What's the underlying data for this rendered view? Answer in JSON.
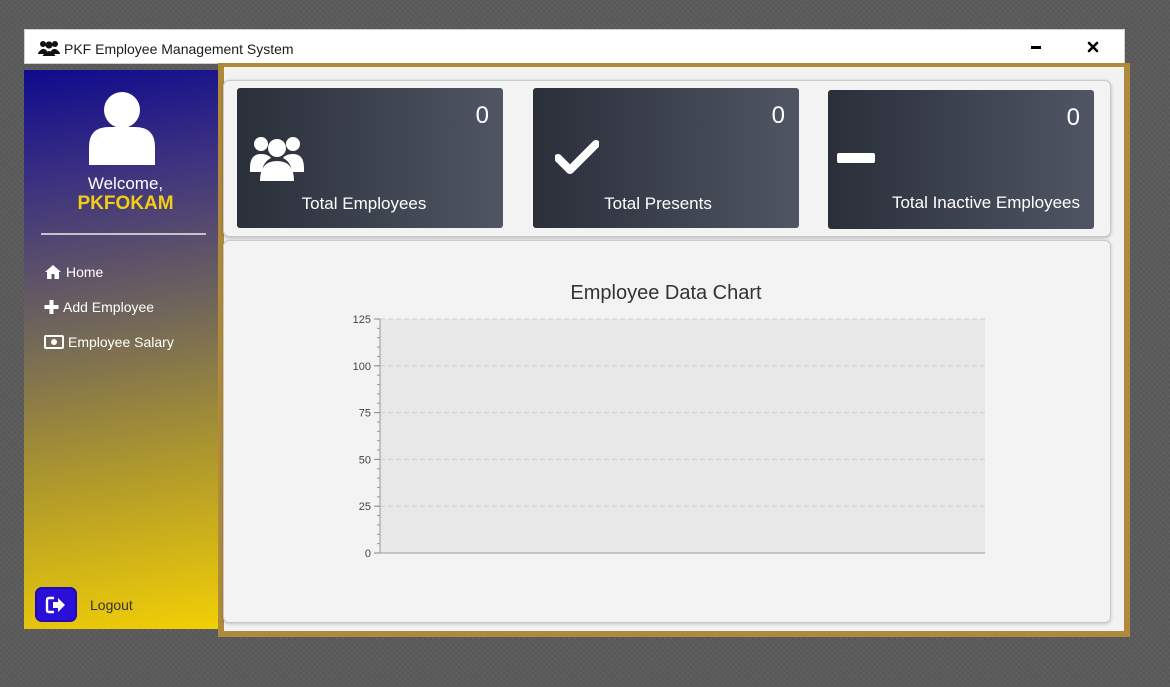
{
  "window": {
    "title": "PKF Employee Management System"
  },
  "sidebar": {
    "welcome": "Welcome,",
    "username": "PKFOKAM",
    "nav": [
      {
        "label": "Home",
        "icon": "home-icon"
      },
      {
        "label": "Add Employee",
        "icon": "plus-icon"
      },
      {
        "label": "Employee Salary",
        "icon": "money-bill-icon"
      }
    ],
    "logout_label": "Logout"
  },
  "cards": [
    {
      "count": "0",
      "label": "Total Employees",
      "icon": "users-icon"
    },
    {
      "count": "0",
      "label": "Total Presents",
      "icon": "check-icon"
    },
    {
      "count": "0",
      "label": "Total Inactive Employees",
      "icon": "minus-icon"
    }
  ],
  "colors": {
    "sidebar_top": "#0e0a8e",
    "sidebar_bottom": "#f2cf05",
    "username": "#f4cc14",
    "card_bg_dark": "#2a2f3a",
    "card_bg_light": "#4f5562",
    "logout_button": "#2a0fd8",
    "frame_border": "#b08a3c"
  },
  "chart_data": {
    "type": "bar",
    "title": "Employee Data Chart",
    "categories": [],
    "values": [],
    "ylim": [
      0,
      125
    ],
    "yticks": [
      "0",
      "25",
      "50",
      "75",
      "100",
      "125"
    ],
    "grid": true
  }
}
